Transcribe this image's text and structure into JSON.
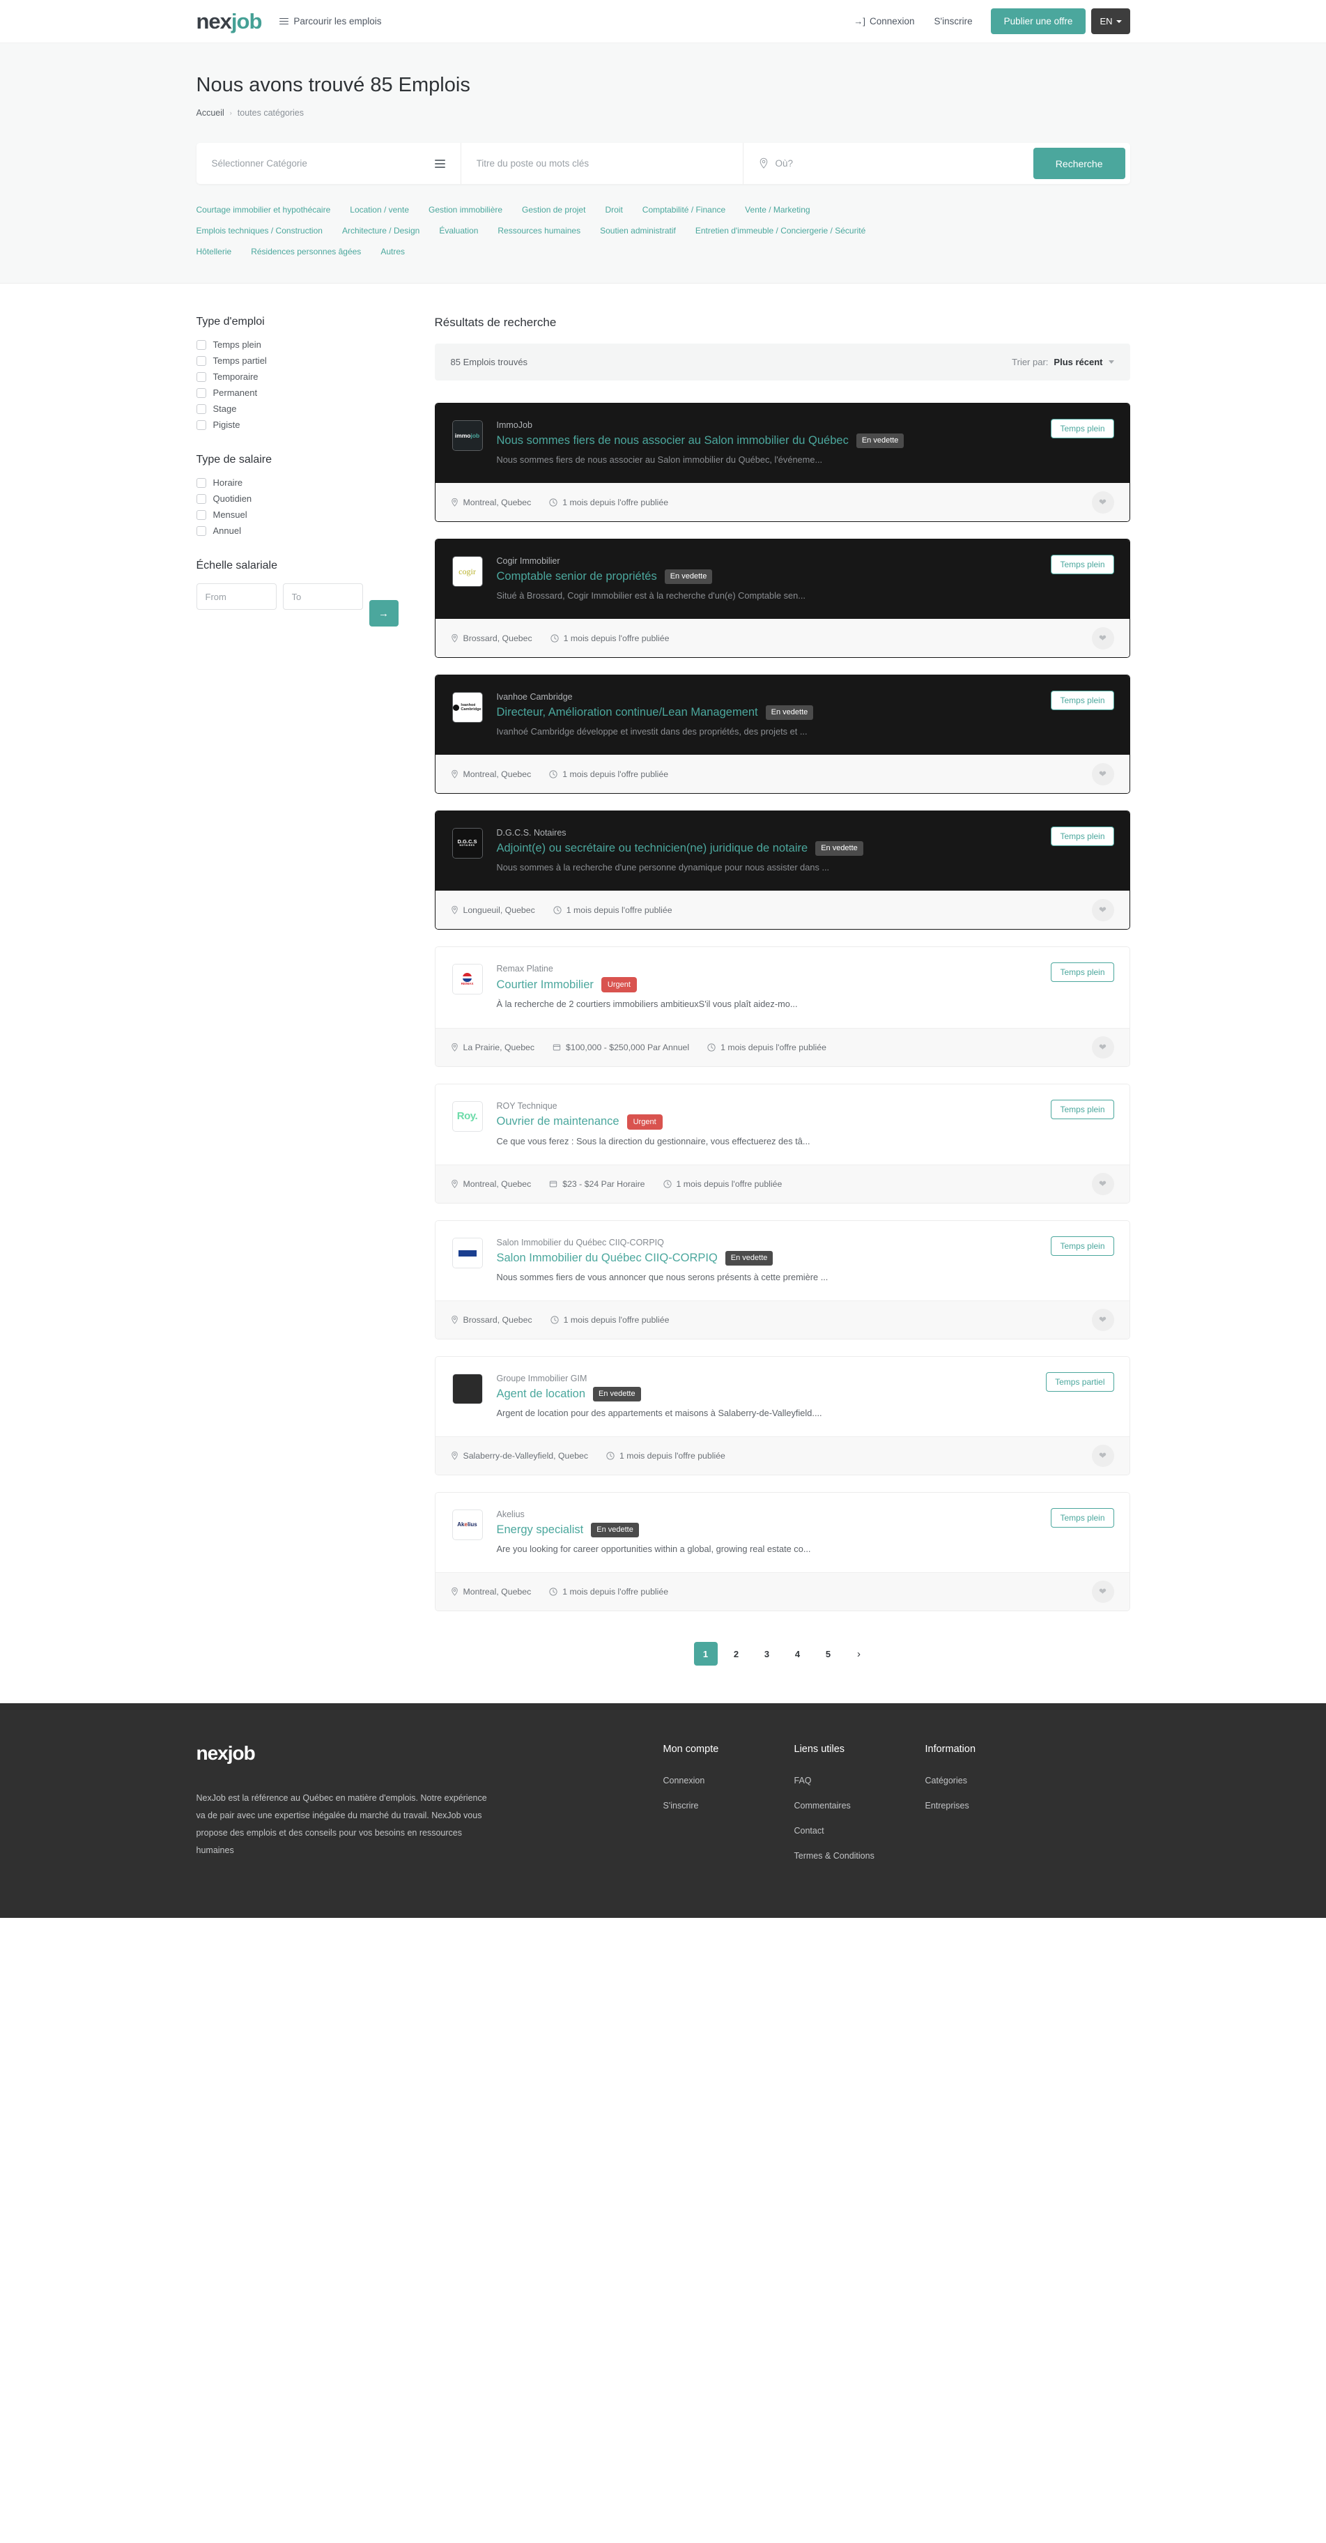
{
  "brand": {
    "part1": "nex",
    "part2": "job"
  },
  "nav": {
    "browse_label": "Parcourir les emplois",
    "login_label": "Connexion",
    "signup_label": "S'inscrire",
    "post_job_label": "Publier une offre",
    "lang_label": "EN"
  },
  "hero": {
    "title": "Nous avons trouvé 85 Emplois",
    "breadcrumb_home": "Accueil",
    "breadcrumb_sep": "›",
    "breadcrumb_current": "toutes catégories",
    "category_placeholder": "Sélectionner Catégorie",
    "keyword_placeholder": "Titre du poste ou mots clés",
    "location_placeholder": "Où?",
    "search_button": "Recherche",
    "categories": [
      "Courtage immobilier et hypothécaire",
      "Location / vente",
      "Gestion immobilière",
      "Gestion de projet",
      "Droit",
      "Comptabilité / Finance",
      "Vente / Marketing",
      "Emplois techniques / Construction",
      "Architecture / Design",
      "Évaluation",
      "Ressources humaines",
      "Soutien administratif",
      "Entretien d'immeuble / Conciergerie / Sécurité",
      "Hôtellerie",
      "Résidences personnes âgées",
      "Autres"
    ]
  },
  "sidebar": {
    "job_type_title": "Type d'emploi",
    "job_types": [
      "Temps plein",
      "Temps partiel",
      "Temporaire",
      "Permanent",
      "Stage",
      "Pigiste"
    ],
    "salary_type_title": "Type de salaire",
    "salary_types": [
      "Horaire",
      "Quotidien",
      "Mensuel",
      "Annuel"
    ],
    "salary_range_title": "Échelle salariale",
    "from_placeholder": "From",
    "to_placeholder": "To",
    "go_icon": "arrow-right-icon"
  },
  "results": {
    "heading": "Résultats de recherche",
    "found_text": "85 Emplois trouvés",
    "sort_label": "Trier par:",
    "sort_value": "Plus récent",
    "jobs": [
      {
        "company": "ImmoJob",
        "title": "Nous sommes fiers de nous associer au Salon immobilier du Québec",
        "badge": "En vedette",
        "badge_kind": "featured",
        "description": "Nous sommes fiers de nous associer au Salon immobilier du Québec, l'événeme...",
        "type": "Temps plein",
        "location": "Montreal, Quebec",
        "salary": "",
        "posted": "1 mois depuis l'offre publiée",
        "theme": "dark"
      },
      {
        "company": "Cogir Immobilier",
        "title": "Comptable senior de propriétés",
        "badge": "En vedette",
        "badge_kind": "featured",
        "description": "Situé à Brossard, Cogir Immobilier est à la recherche d'un(e) Comptable sen...",
        "type": "Temps plein",
        "location": "Brossard, Quebec",
        "salary": "",
        "posted": "1 mois depuis l'offre publiée",
        "theme": "dark"
      },
      {
        "company": "Ivanhoe Cambridge",
        "title": "Directeur, Amélioration continue/Lean Management",
        "badge": "En vedette",
        "badge_kind": "featured",
        "description": "Ivanhoé Cambridge développe et investit dans des propriétés, des projets et ...",
        "type": "Temps plein",
        "location": "Montreal, Quebec",
        "salary": "",
        "posted": "1 mois depuis l'offre publiée",
        "theme": "dark"
      },
      {
        "company": "D.G.C.S. Notaires",
        "title": "Adjoint(e) ou secrétaire ou technicien(ne) juridique de notaire",
        "badge": "En vedette",
        "badge_kind": "featured",
        "description": "Nous sommes à la recherche d'une personne dynamique pour nous assister dans ...",
        "type": "Temps plein",
        "location": "Longueuil, Quebec",
        "salary": "",
        "posted": "1 mois depuis l'offre publiée",
        "theme": "dark"
      },
      {
        "company": "Remax Platine",
        "title": "Courtier Immobilier",
        "badge": "Urgent",
        "badge_kind": "urgent",
        "description": "À la recherche de 2 courtiers immobiliers ambitieuxS'il vous plaît aidez-mo...",
        "type": "Temps plein",
        "location": "La Prairie, Quebec",
        "salary": "$100,000 - $250,000 Par Annuel",
        "posted": "1 mois depuis l'offre publiée",
        "theme": "light"
      },
      {
        "company": "ROY Technique",
        "title": "Ouvrier de maintenance",
        "badge": "Urgent",
        "badge_kind": "urgent",
        "description": "Ce que vous ferez : Sous la direction du gestionnaire, vous effectuerez des tâ...",
        "type": "Temps plein",
        "location": "Montreal, Quebec",
        "salary": "$23 - $24 Par Horaire",
        "posted": "1 mois depuis l'offre publiée",
        "theme": "light"
      },
      {
        "company": "Salon Immobilier du Québec CIIQ-CORPIQ",
        "title": "Salon Immobilier du Québec CIIQ-CORPIQ",
        "badge": "En vedette",
        "badge_kind": "featured",
        "description": "Nous sommes fiers de vous annoncer que nous serons présents à cette première ...",
        "type": "Temps plein",
        "location": "Brossard, Quebec",
        "salary": "",
        "posted": "1 mois depuis l'offre publiée",
        "theme": "light"
      },
      {
        "company": "Groupe Immobilier GIM",
        "title": "Agent de location",
        "badge": "En vedette",
        "badge_kind": "featured",
        "description": "Argent de location pour des appartements et maisons à Salaberry-de-Valleyfield....",
        "type": "Temps partiel",
        "location": "Salaberry-de-Valleyfield, Quebec",
        "salary": "",
        "posted": "1 mois depuis l'offre publiée",
        "theme": "light"
      },
      {
        "company": "Akelius",
        "title": "Energy specialist",
        "badge": "En vedette",
        "badge_kind": "featured",
        "description": "Are you looking for career opportunities within a global, growing real estate co...",
        "type": "Temps plein",
        "location": "Montreal, Quebec",
        "salary": "",
        "posted": "1 mois depuis l'offre publiée",
        "theme": "light"
      }
    ]
  },
  "pagination": {
    "pages": [
      "1",
      "2",
      "3",
      "4",
      "5"
    ],
    "active": "1",
    "next_glyph": "›"
  },
  "footer": {
    "logo": "nexjob",
    "about": "NexJob est la référence au Québec en matière d'emplois. Notre expérience va de pair avec une expertise inégalée du marché du travail. NexJob vous propose des emplois et des conseils pour vos besoins en ressources humaines",
    "columns": [
      {
        "title": "Mon compte",
        "links": [
          "Connexion",
          "S'inscrire"
        ]
      },
      {
        "title": "Liens utiles",
        "links": [
          "FAQ",
          "Commentaires",
          "Contact",
          "Termes & Conditions"
        ]
      },
      {
        "title": "Information",
        "links": [
          "Catégories",
          "Entreprises"
        ]
      }
    ]
  },
  "colors": {
    "accent": "#4ba79d",
    "dark_card": "#171717",
    "urgent": "#d9534f",
    "footer_bg": "#303030"
  }
}
